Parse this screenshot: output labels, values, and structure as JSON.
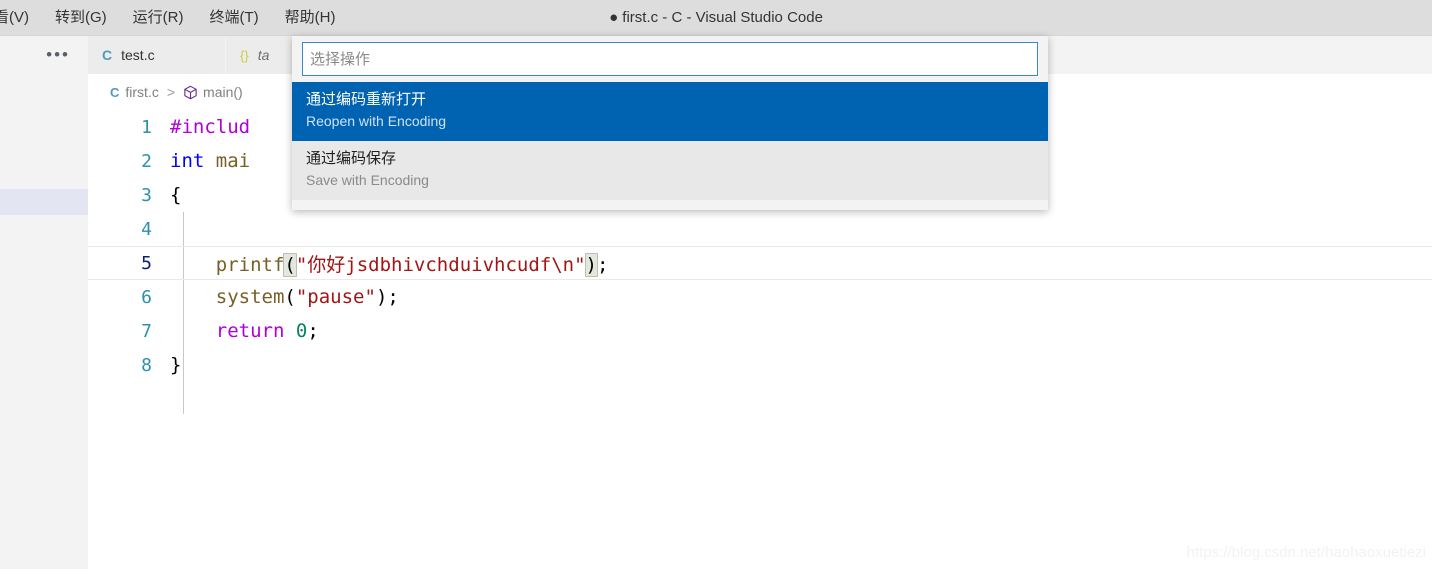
{
  "window": {
    "title": "● first.c - C - Visual Studio Code",
    "dirty_indicator": "●"
  },
  "menubar": {
    "items": [
      {
        "label": "看(V)",
        "clipped": true
      },
      {
        "label": "转到(G)",
        "clipped": false
      },
      {
        "label": "运行(R)",
        "clipped": false
      },
      {
        "label": "终端(T)",
        "clipped": false
      },
      {
        "label": "帮助(H)",
        "clipped": false
      }
    ]
  },
  "sidebar": {
    "more_icon": "•••"
  },
  "tabs": [
    {
      "label": "test.c",
      "icon": "c-file-icon",
      "icon_glyph": "C",
      "preview": false,
      "active": false
    },
    {
      "label": "ta",
      "icon": "json-file-icon",
      "icon_glyph": "{}",
      "preview": true,
      "active": false
    }
  ],
  "breadcrumb": {
    "file_icon_glyph": "C",
    "file": "first.c",
    "separator": ">",
    "symbol": "main()"
  },
  "editor": {
    "lines": [
      {
        "number": "1",
        "current": false,
        "tokens": [
          {
            "text": "#includ",
            "type": "pre"
          }
        ]
      },
      {
        "number": "2",
        "current": false,
        "tokens": [
          {
            "text": "int",
            "type": "type"
          },
          {
            "text": " mai",
            "type": "fn"
          }
        ]
      },
      {
        "number": "3",
        "current": false,
        "tokens": [
          {
            "text": "{",
            "type": "punc"
          }
        ]
      },
      {
        "number": "4",
        "current": false,
        "tokens": []
      },
      {
        "number": "5",
        "current": true,
        "tokens": [
          {
            "text": "    ",
            "type": "plain"
          },
          {
            "text": "printf",
            "type": "fn"
          },
          {
            "text": "(",
            "type": "punc",
            "bracket_match": true
          },
          {
            "text": "\"你好jsdbhivchduivhcudf\\n\"",
            "type": "str"
          },
          {
            "text": ")",
            "type": "punc",
            "bracket_match": true
          },
          {
            "text": ";",
            "type": "punc"
          }
        ]
      },
      {
        "number": "6",
        "current": false,
        "tokens": [
          {
            "text": "    ",
            "type": "plain"
          },
          {
            "text": "system",
            "type": "fn"
          },
          {
            "text": "(",
            "type": "punc"
          },
          {
            "text": "\"pause\"",
            "type": "str"
          },
          {
            "text": ")",
            "type": "punc"
          },
          {
            "text": ";",
            "type": "punc"
          }
        ]
      },
      {
        "number": "7",
        "current": false,
        "tokens": [
          {
            "text": "    ",
            "type": "plain"
          },
          {
            "text": "return",
            "type": "ctrl"
          },
          {
            "text": " ",
            "type": "plain"
          },
          {
            "text": "0",
            "type": "num"
          },
          {
            "text": ";",
            "type": "punc"
          }
        ]
      },
      {
        "number": "8",
        "current": false,
        "tokens": [
          {
            "text": "}",
            "type": "punc"
          }
        ]
      }
    ]
  },
  "quickpick": {
    "placeholder": "选择操作",
    "input_value": "",
    "items": [
      {
        "label": "通过编码重新打开",
        "description": "Reopen with Encoding",
        "selected": true
      },
      {
        "label": "通过编码保存",
        "description": "Save with Encoding",
        "selected": false
      }
    ]
  },
  "watermark": {
    "text": "https://blog.csdn.net/haohaoxuetiezi"
  },
  "colors": {
    "titlebar_bg": "#dddddd",
    "selection_blue": "#0063b1",
    "quickpick_bg": "#e8e8e8",
    "sidebar_bg": "#f3f3f3",
    "editor_bg": "#ffffff",
    "accent_border": "#3b8ac4"
  }
}
